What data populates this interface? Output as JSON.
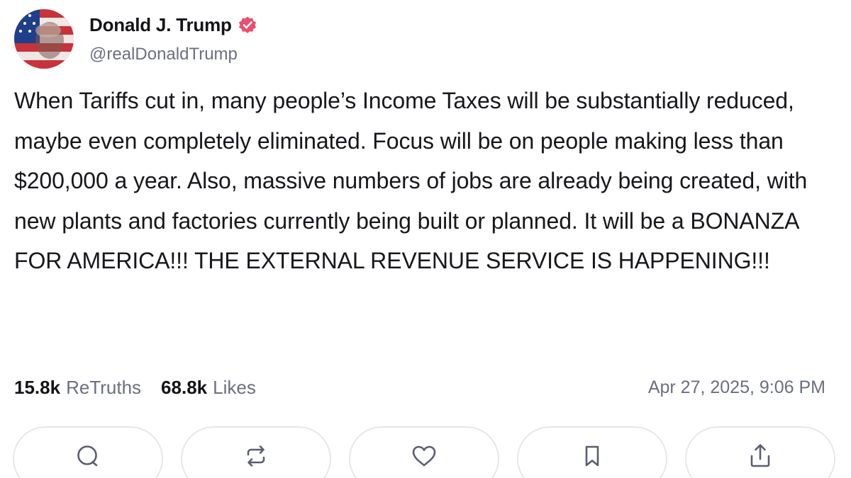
{
  "author": {
    "display_name": "Donald J. Trump",
    "handle": "@realDonaldTrump",
    "verified_icon": "verified-badge-icon",
    "verified_color": "#e8506e"
  },
  "post": {
    "text": "When Tariffs cut in, many people’s Income Taxes will be substantially reduced, maybe even completely eliminated. Focus will be on people making less than $200,000 a year. Also, massive numbers of jobs are already being created, with new plants and factories currently being built or planned. It will be a BONANZA FOR AMERICA!!! THE EXTERNAL REVENUE SERVICE IS HAPPENING!!!"
  },
  "stats": {
    "retruths_count": "15.8k",
    "retruths_label": "ReTruths",
    "likes_count": "68.8k",
    "likes_label": "Likes",
    "timestamp": "Apr 27, 2025, 9:06 PM"
  },
  "actions": [
    {
      "icon": "reply-icon"
    },
    {
      "icon": "retruth-icon"
    },
    {
      "icon": "like-icon"
    },
    {
      "icon": "bookmark-icon"
    },
    {
      "icon": "share-icon"
    }
  ]
}
